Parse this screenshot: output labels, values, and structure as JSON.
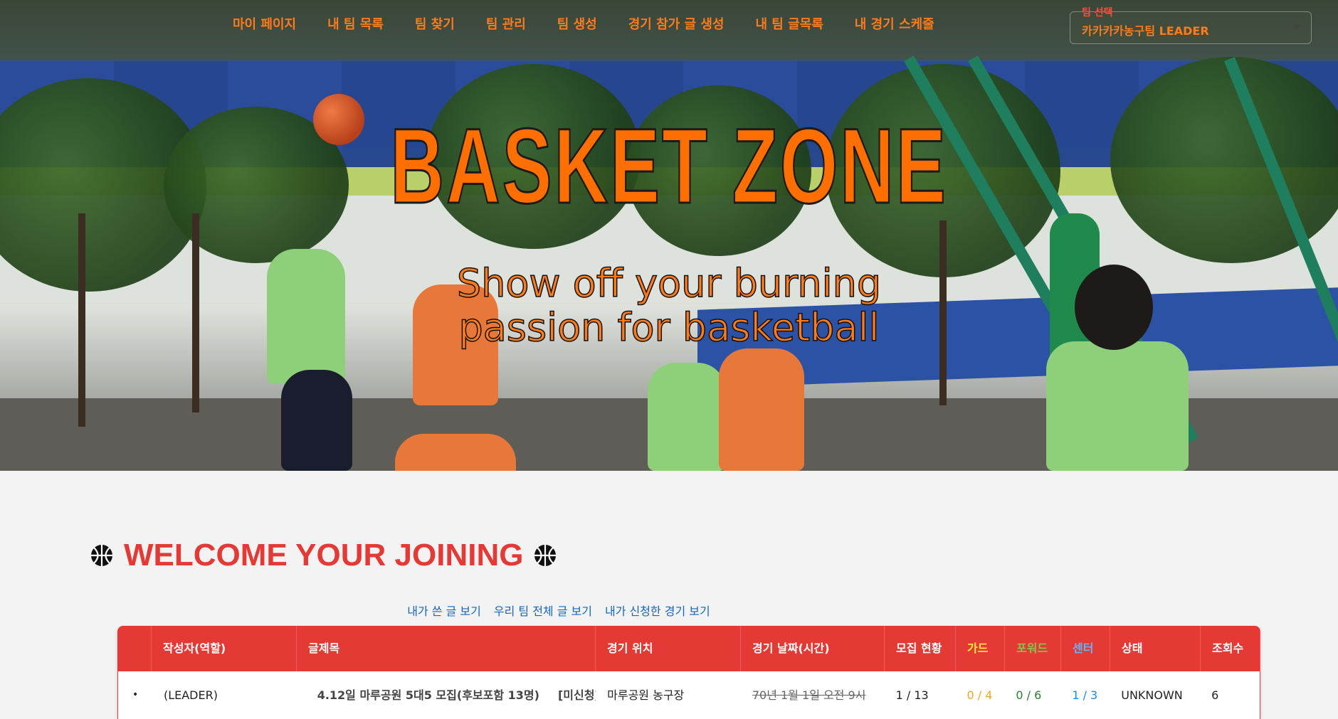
{
  "nav": {
    "items": [
      "마이 페이지",
      "내 팀 목록",
      "팀 찾기",
      "팀 관리",
      "팀 생성",
      "경기 참가 글 생성",
      "내 팀 글목록",
      "내 경기 스케줄"
    ]
  },
  "team_select": {
    "label": "팀 선택",
    "value": "카카카카농구팀 LEADER"
  },
  "hero": {
    "title": "BASKET ZONE",
    "subtitle_line1": "Show off your burning",
    "subtitle_line2": "passion for basketball"
  },
  "welcome": {
    "title": "WELCOME YOUR JOINING"
  },
  "links": [
    "내가 쓴 글 보기",
    "우리 팀 전체 글 보기",
    "내가 신청한 경기 보기"
  ],
  "table": {
    "headers": [
      "",
      "작성자(역할)",
      "글제목",
      "경기 위치",
      "경기 날짜(시간)",
      "모집 현황",
      "가드",
      "포워드",
      "센터",
      "상태",
      "조회수"
    ],
    "header_colors": {
      "guard": "#ffeb3b",
      "forward": "#8bc34a",
      "center": "#64b5f6"
    },
    "rows": [
      {
        "bullet": "•",
        "author": "(LEADER)",
        "title": "4.12일 마루공원 5대5 모집(후보포함 13명)",
        "title_status": "[미신청]",
        "location": "마루공원 농구장",
        "datetime": "70년 1월 1일 오전 9시",
        "recruit": "1 / 13",
        "guard": "0 / 4",
        "forward": "0 / 6",
        "center": "1 / 3",
        "status": "UNKNOWN",
        "views": "6"
      }
    ]
  },
  "colors": {
    "accent_orange": "#ff7a18",
    "accent_red": "#e53935",
    "link_blue": "#1565c0",
    "guard_value": "#f5a623",
    "forward_value": "#2e7d32",
    "center_value": "#1e88e5"
  }
}
